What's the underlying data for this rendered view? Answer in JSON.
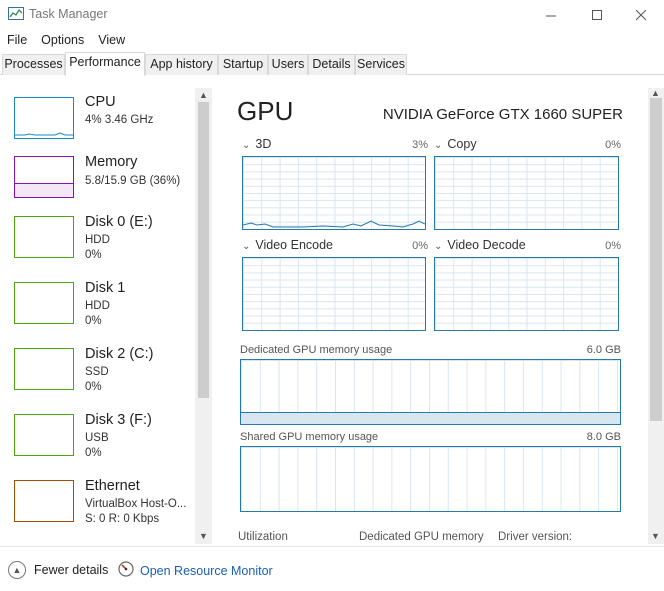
{
  "window": {
    "title": "Task Manager"
  },
  "menu": [
    "File",
    "Options",
    "View"
  ],
  "tabs": [
    "Processes",
    "Performance",
    "App history",
    "Startup",
    "Users",
    "Details",
    "Services"
  ],
  "active_tab": "Performance",
  "resources": [
    {
      "name": "CPU",
      "line1": "4%  3.46 GHz",
      "line2": "",
      "color": "#1a88c9"
    },
    {
      "name": "Memory",
      "line1": "5.8/15.9 GB (36%)",
      "line2": "",
      "color": "#8b12ae"
    },
    {
      "name": "Disk 0 (E:)",
      "line1": "HDD",
      "line2": "0%",
      "color": "#4da60c"
    },
    {
      "name": "Disk 1",
      "line1": "HDD",
      "line2": "0%",
      "color": "#4da60c"
    },
    {
      "name": "Disk 2 (C:)",
      "line1": "SSD",
      "line2": "0%",
      "color": "#4da60c"
    },
    {
      "name": "Disk 3 (F:)",
      "line1": "USB",
      "line2": "0%",
      "color": "#4da60c"
    },
    {
      "name": "Ethernet",
      "line1": "VirtualBox Host-O...",
      "line2": "S: 0  R: 0 Kbps",
      "color": "#a74f01"
    }
  ],
  "gpu": {
    "title": "GPU",
    "model": "NVIDIA GeForce GTX 1660 SUPER",
    "engines": [
      {
        "label": "3D",
        "percent": "3%"
      },
      {
        "label": "Copy",
        "percent": "0%"
      },
      {
        "label": "Video Encode",
        "percent": "0%"
      },
      {
        "label": "Video Decode",
        "percent": "0%"
      }
    ],
    "dedicated": {
      "label": "Dedicated GPU memory usage",
      "value": "6.0 GB"
    },
    "shared": {
      "label": "Shared GPU memory usage",
      "value": "8.0 GB"
    },
    "stats": {
      "utilization": "Utilization",
      "dedicated_memory": "Dedicated GPU memory",
      "driver_version": "Driver version:"
    }
  },
  "footer": {
    "fewer_details": "Fewer details",
    "open_resource_monitor": "Open Resource Monitor"
  },
  "colors": {
    "graph_border": "#2779a8",
    "link": "#1a5fb4"
  }
}
